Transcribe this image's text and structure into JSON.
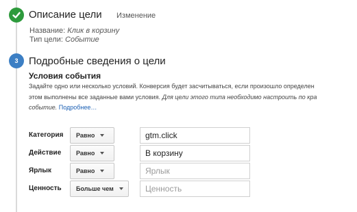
{
  "step1": {
    "title": "Описание цели",
    "edit_label": "Изменение",
    "name_label": "Название:",
    "name_value": "Клик в корзину",
    "type_label": "Тип цели:",
    "type_value": "Событие"
  },
  "step2": {
    "number": "3",
    "title": "Подробные сведения о цели",
    "section_title": "Условия события",
    "desc_line1": "Задайте одно или несколько условий. Конверсия будет засчитываться, если произошло определен",
    "desc_line2_plain": "этом выполнены все заданные вами условия.",
    "desc_line2_italic": "Для цели этого типа необходимо настроить по кра",
    "desc_line3_italic": "событие.",
    "desc_link": "Подробнее…"
  },
  "conditions": [
    {
      "label": "Категория",
      "operator": "Равно",
      "value": "gtm.click",
      "placeholder": ""
    },
    {
      "label": "Действие",
      "operator": "Равно",
      "value": "В корзину",
      "placeholder": ""
    },
    {
      "label": "Ярлык",
      "operator": "Равно",
      "value": "",
      "placeholder": "Ярлык"
    },
    {
      "label": "Ценность",
      "operator": "Больше чем",
      "value": "",
      "placeholder": "Ценность"
    }
  ],
  "colors": {
    "done": "#2d9a3c",
    "active": "#3c7fc4",
    "link": "#1a5fb4"
  },
  "icons": {
    "step1": "checkmark-icon",
    "dropdown": "caret-down-icon"
  }
}
